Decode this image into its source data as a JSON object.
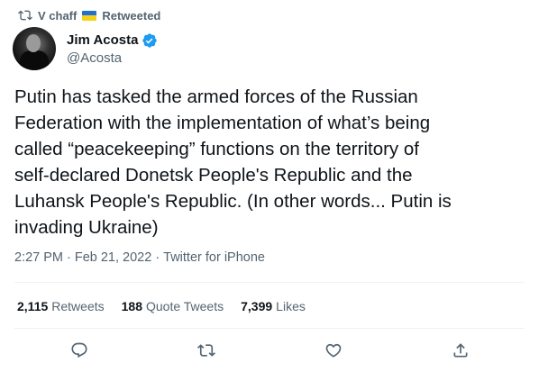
{
  "retweet_context": {
    "user": "V chaff",
    "label": "Retweeted",
    "icon": "retweet-icon",
    "flag_colors": [
      "#1f6fd6",
      "#f6d11a"
    ]
  },
  "author": {
    "display_name": "Jim Acosta",
    "handle": "@Acosta",
    "verified_color": "#1d9bf0"
  },
  "tweet": {
    "text": "Putin has tasked the armed forces of the Russian\nFederation with the implementation of what’s being\ncalled “peacekeeping” functions on the territory of\nself-declared  Donetsk People's Republic and the\nLuhansk People's Republic. (In other words... Putin is\ninvading Ukraine)",
    "time": "2:27 PM",
    "date": "Feb 21, 2022",
    "source": "Twitter for iPhone"
  },
  "stats": {
    "retweets": {
      "count": "2,115",
      "label": "Retweets"
    },
    "quote_tweets": {
      "count": "188",
      "label": "Quote Tweets"
    },
    "likes": {
      "count": "7,399",
      "label": "Likes"
    }
  },
  "actions": [
    "reply-icon",
    "retweet-icon",
    "like-icon",
    "share-icon"
  ],
  "colors": {
    "secondary_text": "#536471",
    "primary_text": "#0f1419",
    "accent": "#1d9bf0"
  }
}
